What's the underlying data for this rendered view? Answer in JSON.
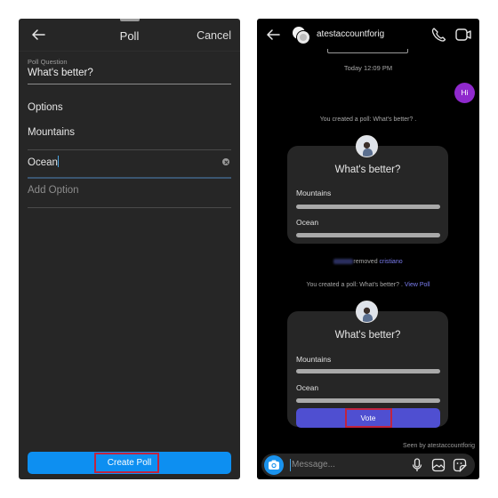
{
  "left_screen": {
    "header": {
      "back_icon": "arrow-left-icon",
      "title": "Poll",
      "cancel_label": "Cancel"
    },
    "poll_question": {
      "label": "Poll Question",
      "value": "What's better?"
    },
    "options_label": "Options",
    "options": [
      {
        "value": "Mountains"
      },
      {
        "value": "Ocean",
        "focused": true,
        "clear_icon": "clear-circle-icon"
      }
    ],
    "add_option_placeholder": "Add Option",
    "create_button_label": "Create Poll",
    "accent_color": "#0d8ff1",
    "highlight_color": "#c1243f"
  },
  "right_screen": {
    "header": {
      "back_icon": "arrow-left-icon",
      "username": "atestaccountforig",
      "call_icon": "phone-icon",
      "video_icon": "video-camera-icon"
    },
    "timestamp": "Today 12:09 PM",
    "messages": [
      {
        "type": "sent",
        "text": "Hi",
        "bubble_color": "#8f29cd"
      }
    ],
    "system_messages": {
      "poll_created_1": "You created a poll: What's better? .",
      "removed_suffix": "removed",
      "removed_user": "cristiano",
      "poll_created_2": "You created a poll: What's better? .",
      "view_poll_link": "View Poll"
    },
    "polls": [
      {
        "question": "What's better?",
        "options": [
          {
            "label": "Mountains",
            "votes_fraction": 0
          },
          {
            "label": "Ocean",
            "votes_fraction": 0
          }
        ]
      },
      {
        "question": "What's better?",
        "options": [
          {
            "label": "Mountains",
            "votes_fraction": 0
          },
          {
            "label": "Ocean",
            "votes_fraction": 0
          }
        ],
        "vote_button_label": "Vote",
        "vote_color": "#4f4fd1"
      }
    ],
    "seen_by": "Seen by atestaccountforig",
    "composer": {
      "camera_icon": "camera-icon",
      "placeholder": "Message...",
      "mic_icon": "microphone-icon",
      "gallery_icon": "image-gallery-icon",
      "sticker_icon": "sticker-icon"
    },
    "link_color": "#7b7df0"
  }
}
